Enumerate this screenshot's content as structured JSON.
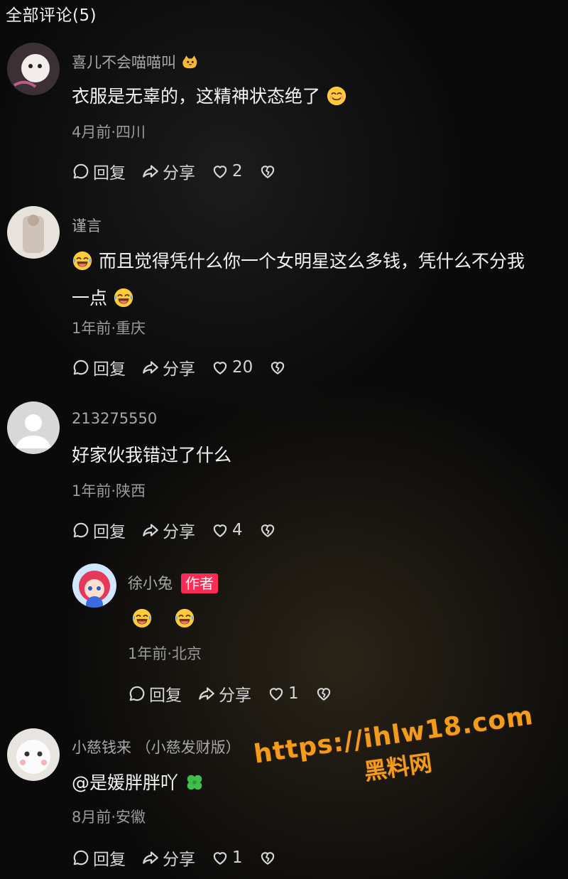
{
  "header": {
    "title": "全部评论(5)"
  },
  "comments": [
    {
      "name": "喜儿不会喵喵叫",
      "text": "衣服是无辜的，这精神状态绝了",
      "meta": "4月前·四川",
      "reply": "回复",
      "share": "分享",
      "likes": "2"
    },
    {
      "name": "谨言",
      "text1": "而且觉得凭什么你一个女明星这么多钱，凭什么不分我",
      "text2": "一点",
      "meta": "1年前·重庆",
      "reply": "回复",
      "share": "分享",
      "likes": "20"
    },
    {
      "name": "213275550",
      "text": "好家伙我错过了什么",
      "meta": "1年前·陕西",
      "reply": "回复",
      "share": "分享",
      "likes": "4"
    },
    {
      "name": "徐小兔",
      "badge": "作者",
      "meta": "1年前·北京",
      "reply": "回复",
      "share": "分享",
      "likes": "1"
    },
    {
      "name": "小慈钱来 （小慈发财版）",
      "text": "@是媛胖胖吖",
      "meta": "8月前·安徽",
      "reply": "回复",
      "share": "分享",
      "likes": "1"
    }
  ],
  "watermark": {
    "url": "https://ihlw18.com",
    "cn": "黑料网"
  },
  "icons": {
    "reply": "comment-bubble-icon",
    "share": "share-arrow-icon",
    "like": "heart-icon",
    "dislike": "broken-heart-icon",
    "cat_emoji": "cat-emoji-icon",
    "smile_emoji": "smile-emoji-icon",
    "laugh_emoji": "laugh-cry-emoji-icon",
    "clover_emoji": "clover-icon"
  },
  "colors": {
    "author_badge": "#fe2c55",
    "watermark": "#f39b1a"
  }
}
